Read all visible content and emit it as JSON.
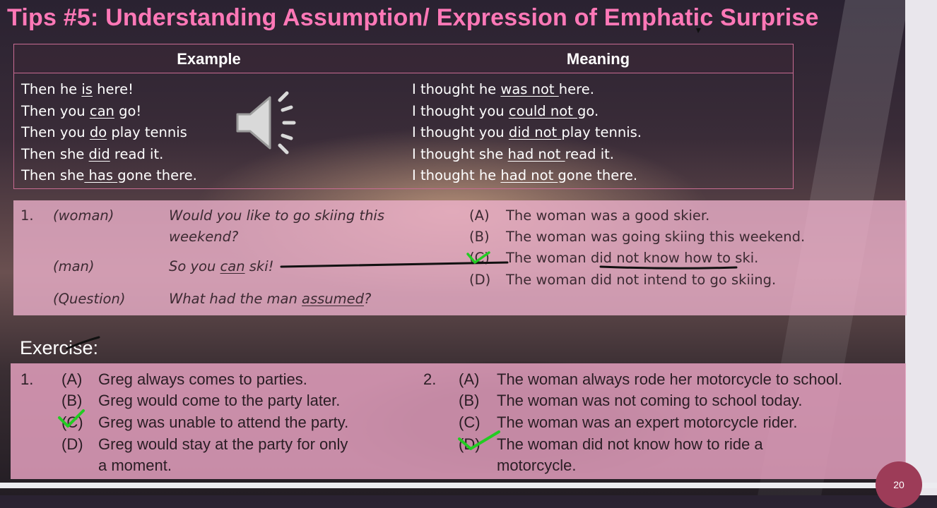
{
  "slide": {
    "title": "Tips #5: Understanding Assumption/ Expression of Emphatic Surprise",
    "page_number": "20"
  },
  "table": {
    "headers": [
      "Example",
      "Meaning"
    ],
    "examples": [
      {
        "pre": "Then he ",
        "u": "is",
        "post": " here!"
      },
      {
        "pre": "Then you ",
        "u": "can",
        "post": " go!"
      },
      {
        "pre": "Then you ",
        "u": "do",
        "post": " play tennis"
      },
      {
        "pre": "Then she ",
        "u": "did",
        "post": " read it."
      },
      {
        "pre": "Then she",
        "u": " has ",
        "post": "gone there."
      }
    ],
    "meanings": [
      {
        "pre": "I thought he ",
        "u": "was not ",
        "post": "here."
      },
      {
        "pre": "I thought you ",
        "u": "could not ",
        "post": "go."
      },
      {
        "pre": "I thought you ",
        "u": "did not ",
        "post": "play tennis."
      },
      {
        "pre": "I thought she ",
        "u": "had not ",
        "post": "read it."
      },
      {
        "pre": "I thought he ",
        "u": "had not ",
        "post": "gone there."
      }
    ]
  },
  "question1": {
    "number": "1.",
    "woman_label": "(woman)",
    "woman_line1": "Would you like to go skiing this",
    "woman_line2": "weekend?",
    "man_label": "(man)",
    "man_pre": "So you ",
    "man_u": "can",
    "man_post": " ski!",
    "q_label": "(Question)",
    "q_pre": "What had the man ",
    "q_u": "assumed",
    "q_post": "?",
    "options": [
      {
        "letter": "(A)",
        "text": "The woman was a good skier."
      },
      {
        "letter": "(B)",
        "text": "The woman was going skiing this weekend."
      },
      {
        "letter": "(C)",
        "text": "The woman did not know how to ski."
      },
      {
        "letter": "(D)",
        "text": "The woman did not intend to go skiing."
      }
    ]
  },
  "exercise": {
    "label": "Exercise:",
    "q1": {
      "number": "1.",
      "options": [
        {
          "letter": "(A)",
          "text": "Greg always comes to parties."
        },
        {
          "letter": "(B)",
          "text": "Greg would come to the party later."
        },
        {
          "letter": "(C)",
          "text": "Greg was unable to attend the party."
        },
        {
          "letter": "(D)",
          "text": "Greg would stay at the party for only"
        }
      ],
      "continuation": "a moment."
    },
    "q2": {
      "number": "2.",
      "options": [
        {
          "letter": "(A)",
          "text": "The woman always rode her motorcycle to school."
        },
        {
          "letter": "(B)",
          "text": "The woman was not coming to school today."
        },
        {
          "letter": "(C)",
          "text": "The woman was an expert motorcycle rider."
        },
        {
          "letter": "(D)",
          "text": "The woman did not know how to ride a"
        }
      ],
      "continuation": "motorcycle."
    }
  },
  "colors": {
    "title": "#ff78b7",
    "check": "#22cc22",
    "badge": "#9d3c58"
  }
}
